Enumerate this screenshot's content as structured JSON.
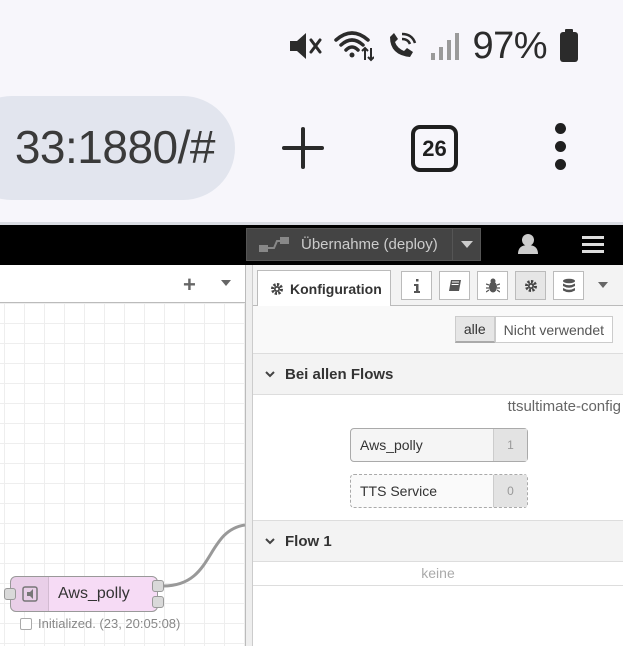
{
  "status_bar": {
    "icons": [
      "mute-icon",
      "wifi-icon",
      "wifi-calling-icon",
      "signal-icon",
      "battery-icon"
    ],
    "battery_percent": "97%"
  },
  "browser": {
    "url_visible": "33:1880/#",
    "tab_count": "26",
    "new_tab_icon": "plus-icon",
    "menu_icon": "kebab-menu-icon"
  },
  "header": {
    "deploy_label": "Übernahme (deploy)"
  },
  "workspace": {
    "node": {
      "label": "Aws_polly",
      "status": "Initialized. (23, 20:05:08)",
      "color": "#f6dbf5"
    }
  },
  "sidebar": {
    "active_tab": "Konfiguration",
    "tab_buttons": [
      "info-icon",
      "book-icon",
      "bug-icon",
      "gear-icon",
      "database-icon"
    ],
    "filters": [
      "alle",
      "Nicht verwendet"
    ],
    "sections": [
      {
        "title": "Bei allen Flows",
        "type_label": "ttsultimate-config",
        "items": [
          {
            "name": "Aws_polly",
            "count": "1"
          },
          {
            "name": "TTS Service",
            "count": "0"
          }
        ]
      },
      {
        "title": "Flow 1",
        "empty_text": "keine"
      }
    ]
  },
  "colors": {
    "header_bg": "#000000",
    "node_fill": "#f6dbf5",
    "browser_bg": "#f7f6fb"
  }
}
